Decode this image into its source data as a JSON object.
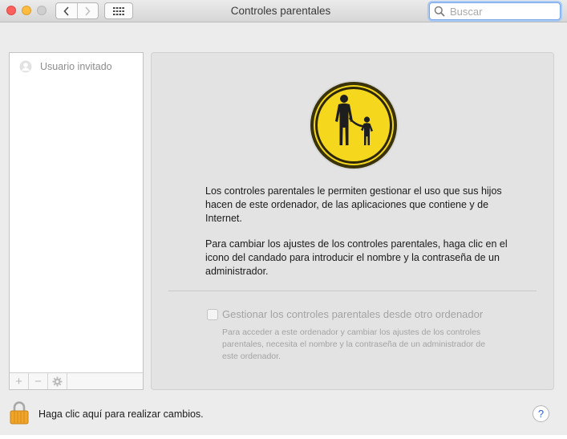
{
  "window": {
    "title": "Controles parentales"
  },
  "search": {
    "placeholder": "Buscar",
    "value": ""
  },
  "sidebar": {
    "users": [
      {
        "label": "Usuario invitado",
        "icon": "user-silhouette-icon"
      }
    ],
    "toolbar": {
      "add_label": "+",
      "remove_label": "−"
    }
  },
  "main": {
    "paragraph1": "Los controles parentales le permiten gestionar el uso que sus hijos hacen de este ordenador, de las aplicaciones que contiene y de Internet.",
    "paragraph2": "Para cambiar los ajustes de los controles parentales, haga clic en el icono del candado para introducir el nombre y la contraseña de un administrador.",
    "remote_checkbox": {
      "label": "Gestionar los controles parentales desde otro ordenador",
      "checked": false,
      "enabled": false
    },
    "remote_description": "Para acceder a este ordenador y cambiar los ajustes de los controles parentales, necesita el nombre y la contraseña de un administrador de este ordenador."
  },
  "footer": {
    "lock_text": "Haga clic aquí para realizar cambios.",
    "help_label": "?"
  },
  "colors": {
    "icon_yellow": "#f5d81e",
    "accent_blue": "#2a62c9"
  }
}
